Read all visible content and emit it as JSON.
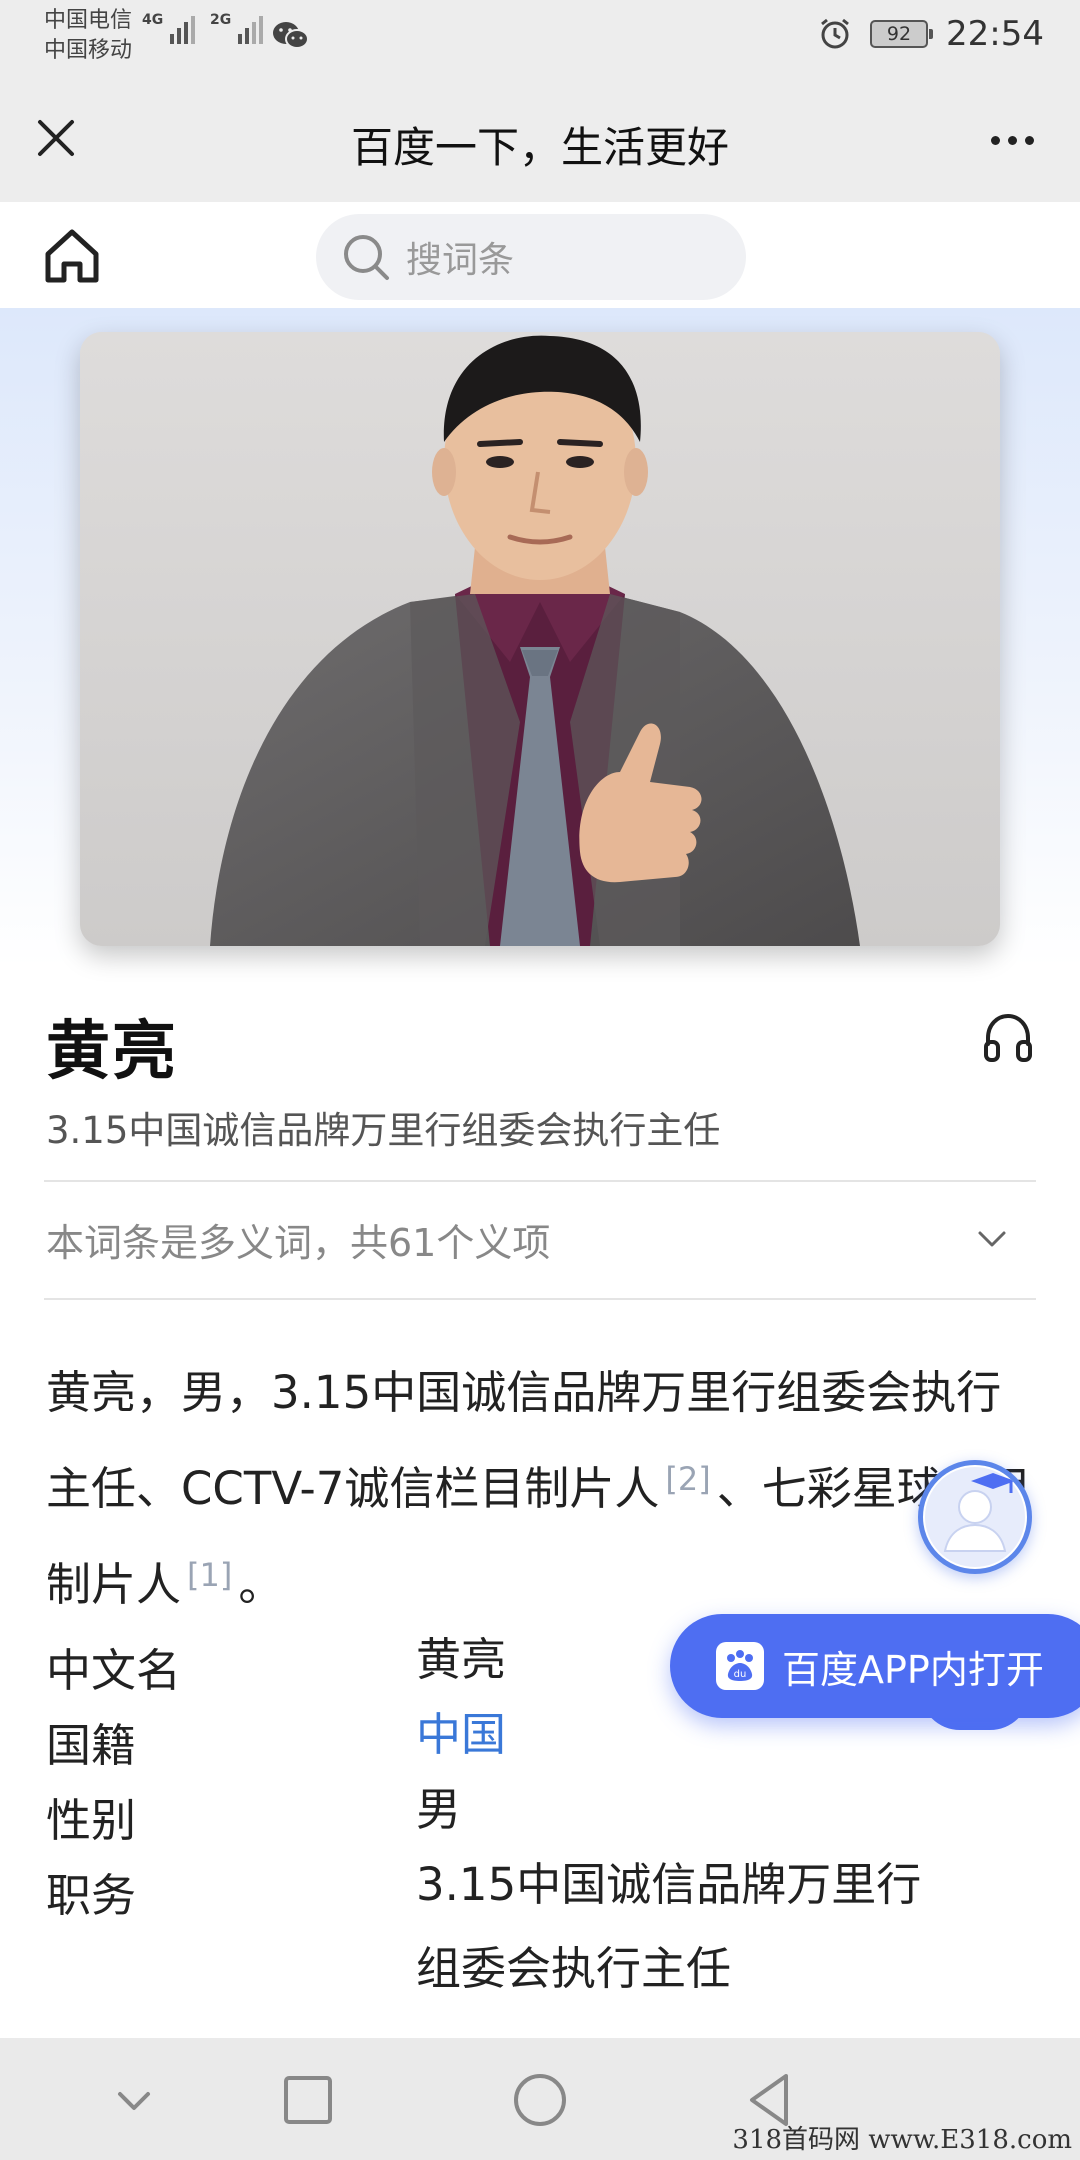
{
  "status_bar": {
    "carrier_1": "中国电信",
    "carrier_2": "中国移动",
    "network_1": "4G",
    "network_2": "2G",
    "battery": "92",
    "time": "22:54"
  },
  "header": {
    "title": "百度一下，生活更好"
  },
  "search": {
    "placeholder": "搜词条"
  },
  "entry": {
    "title": "黄亮",
    "subtitle": "3.15中国诚信品牌万里行组委会执行主任",
    "polysemy_note": "本词条是多义词，共61个义项",
    "summary_part1": "黄亮，男，3.15中国诚信品牌万里行组委会执行主任、CCTV-7诚信栏目制片人",
    "ref_2": "[2]",
    "summary_part2": "、七彩星球栏目制片人",
    "ref_1": "[1]",
    "summary_end": "。"
  },
  "info": {
    "rows": [
      {
        "key": "中文名",
        "value": "黄亮"
      },
      {
        "key": "国籍",
        "value": "中国"
      },
      {
        "key": "性别",
        "value": "男"
      },
      {
        "key": "职务",
        "value": "3.15中国诚信品牌万里行组委会执行主任"
      }
    ]
  },
  "float": {
    "open_app_label": "百度APP内打开",
    "app_icon_text": "du"
  },
  "watermark": "318首码网 www.E318.com",
  "colors": {
    "accent": "#4e6ef2",
    "link": "#3a78d8"
  }
}
